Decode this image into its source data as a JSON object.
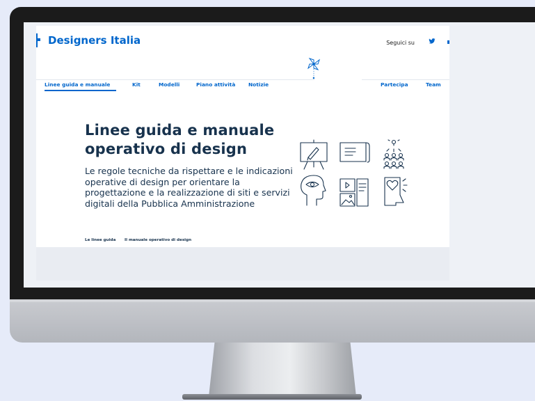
{
  "brand": {
    "name": "Designers Italia",
    "color": "#0066cc"
  },
  "header": {
    "follow_label": "Seguici su",
    "social_icon": "twitter-icon"
  },
  "nav": {
    "items": [
      {
        "label": "Linee guida e manuale",
        "active": true
      },
      {
        "label": "Kit"
      },
      {
        "label": "Modelli"
      },
      {
        "label": "Piano attività"
      },
      {
        "label": "Notizie"
      },
      {
        "label": "Partecipa"
      },
      {
        "label": "Team"
      }
    ]
  },
  "hero": {
    "title_line1": "Linee guida e manuale",
    "title_line2": "operativo di design",
    "description": "Le regole tecniche da rispettare e le indicazioni operative di design per orientare la progettazione e la realizzazione di siti e servizi digitali della Pubblica Amministrazione",
    "links": [
      "Le linee guida",
      "Il manuale operativo di design"
    ]
  },
  "illustrations": [
    "easel-pencil-icon",
    "document-scroll-icon",
    "idea-team-icon",
    "eye-head-icon",
    "media-layout-icon",
    "heart-phone-icon"
  ],
  "colors": {
    "text_dark": "#17324d",
    "background": "#e6ebf9",
    "bezel": "#1b1b1b"
  }
}
